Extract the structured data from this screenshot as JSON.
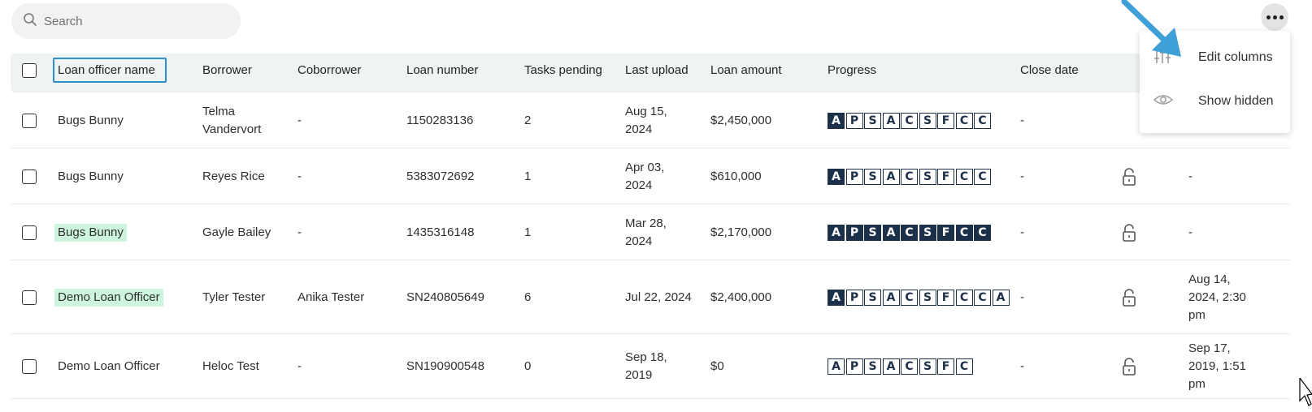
{
  "search": {
    "placeholder": "Search"
  },
  "columns": {
    "loan_officer": "Loan officer name",
    "borrower": "Borrower",
    "coborrower": "Coborrower",
    "loan_number": "Loan number",
    "tasks_pending": "Tasks pending",
    "last_upload": "Last upload",
    "loan_amount": "Loan amount",
    "progress": "Progress",
    "close_date": "Close date"
  },
  "menu": {
    "edit_columns": "Edit columns",
    "show_hidden": "Show hidden"
  },
  "rows": [
    {
      "officer": "Bugs Bunny",
      "borrower": "Telma Vandervort",
      "coborrower": "-",
      "loan_number": "1150283136",
      "tasks": "2",
      "last_upload": "Aug 15, 2024",
      "amount": "$2,450,000",
      "progress": [
        "A",
        "P",
        "S",
        "A",
        "C",
        "S",
        "F",
        "C",
        "C"
      ],
      "progress_filled": 1,
      "close_date": "-",
      "extra": ""
    },
    {
      "officer": "Bugs Bunny",
      "borrower": "Reyes Rice",
      "coborrower": "-",
      "loan_number": "5383072692",
      "tasks": "1",
      "last_upload": "Apr 03, 2024",
      "amount": "$610,000",
      "progress": [
        "A",
        "P",
        "S",
        "A",
        "C",
        "S",
        "F",
        "C",
        "C"
      ],
      "progress_filled": 1,
      "close_date": "-",
      "extra": "-"
    },
    {
      "officer": "Bugs Bunny",
      "borrower": "Gayle Bailey",
      "coborrower": "-",
      "loan_number": "1435316148",
      "tasks": "1",
      "last_upload": "Mar 28, 2024",
      "amount": "$2,170,000",
      "progress": [
        "A",
        "P",
        "S",
        "A",
        "C",
        "S",
        "F",
        "C",
        "C"
      ],
      "progress_filled": 9,
      "close_date": "-",
      "extra": "-"
    },
    {
      "officer": "Demo Loan Officer",
      "borrower": "Tyler Tester",
      "coborrower": "Anika Tester",
      "loan_number": "SN240805649",
      "tasks": "6",
      "last_upload": "Jul 22, 2024",
      "amount": "$2,400,000",
      "progress": [
        "A",
        "P",
        "S",
        "A",
        "C",
        "S",
        "F",
        "C",
        "C",
        "A"
      ],
      "progress_filled": 1,
      "close_date": "-",
      "extra": "Aug 14, 2024, 2:30 pm"
    },
    {
      "officer": "Demo Loan Officer",
      "borrower": "Heloc Test",
      "coborrower": "-",
      "loan_number": "SN190900548",
      "tasks": "0",
      "last_upload": "Sep 18, 2019",
      "amount": "$0",
      "progress": [
        "A",
        "P",
        "S",
        "A",
        "C",
        "S",
        "F",
        "C"
      ],
      "progress_filled": 0,
      "close_date": "-",
      "extra": "Sep 17, 2019, 1:51 pm"
    }
  ]
}
